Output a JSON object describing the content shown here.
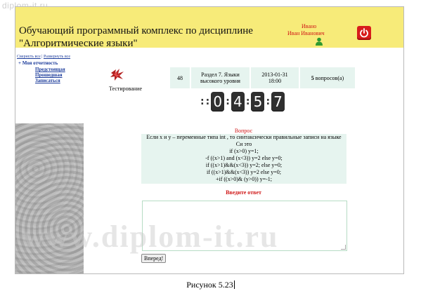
{
  "watermark_top": "diplom-it.ru",
  "watermark_big": "www.diplom-it.ru",
  "header": {
    "title_line1": "Обучающий программный комплекс по дисциплине",
    "title_line2": "\"Алгоритмические языки\"",
    "user_short": "Ивано",
    "user_full": "Иван Иванович",
    "bg_color": "#f7eb79",
    "accent_color": "#d01818"
  },
  "sidebar": {
    "collapse_all": "Свернуть все",
    "separator": " | ",
    "expand_all": "Развернуть все",
    "bullet": "+",
    "my_reports": "Моя отчетность",
    "items": [
      "Предстоящая",
      "Прошедшая",
      "Записаться"
    ]
  },
  "test": {
    "label": "Тестирование",
    "number": "48",
    "section": "Раздел 7. Языки высокого уровня",
    "date": "2013-01-31",
    "time": "18:00",
    "questions_count": "5",
    "questions_suffix": " вопросов(а)"
  },
  "timer": {
    "sep": ":",
    "digits": [
      "0",
      "4",
      "5",
      "7"
    ]
  },
  "question": {
    "title": "Вопрос",
    "lines": [
      "Если x и y – переменные типа int , то синтаксически правильные записи на языке",
      "Си это",
      "if (x>0) y=1;",
      "-f ((x>1) and (x<3)) y=2 else y=0;",
      "if ((x>1)&&(x<3)) y=2; else y=0;",
      "if ((x>1)&&(x<3)) y=2 else y=0;",
      "+if ((x>0)& (y>0)) y=-1;"
    ]
  },
  "answer": {
    "title": "Введите ответ",
    "value": "",
    "next_label": "Вперед!"
  },
  "caption": "Рисунок 5.23"
}
